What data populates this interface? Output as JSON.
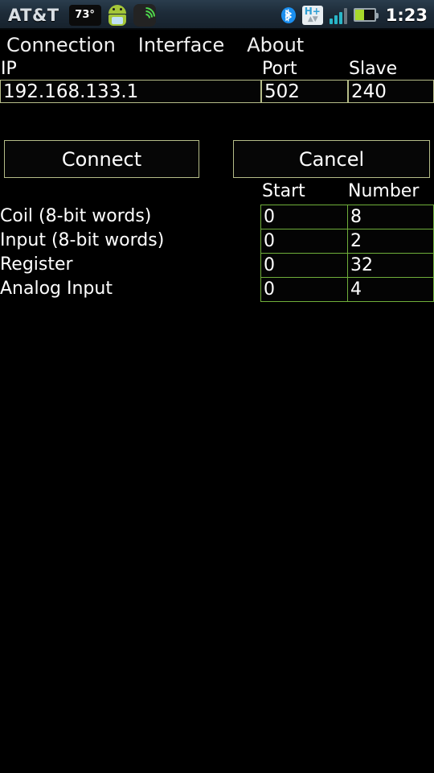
{
  "statusbar": {
    "carrier": "AT&T",
    "weather_temp": "73°",
    "android_icon": "android-robot-icon",
    "spotify_icon": "spotify-icon",
    "bluetooth_icon": "bluetooth-icon",
    "network_type": "H+",
    "network_arrows": "▲▼",
    "signal_bars_lit": 3,
    "signal_bars_total": 4,
    "battery_percent": 45,
    "battery_color": "#a8d92b",
    "clock": "1:23"
  },
  "tabs": [
    {
      "label": "Connection",
      "name": "tab-connection",
      "selected": true
    },
    {
      "label": "Interface",
      "name": "tab-interface",
      "selected": false
    },
    {
      "label": "About",
      "name": "tab-about",
      "selected": false
    }
  ],
  "connection": {
    "ip_label": "IP",
    "ip_value": "192.168.133.1",
    "ip_placeholder": "IP",
    "port_label": "Port",
    "port_value": "502",
    "port_placeholder": "Port",
    "slave_label": "Slave",
    "slave_value": "240",
    "slave_placeholder": "Slave",
    "connect_label": "Connect",
    "cancel_label": "Cancel"
  },
  "registers": {
    "columns": [
      "Start",
      "Number"
    ],
    "col_start": "Start",
    "col_number": "Number",
    "rows": [
      {
        "label": "Coil (8-bit words)",
        "start": "0",
        "number": "8"
      },
      {
        "label": "Input (8-bit words)",
        "start": "0",
        "number": "2"
      },
      {
        "label": "Register",
        "start": "0",
        "number": "32"
      },
      {
        "label": "Analog Input",
        "start": "0",
        "number": "4"
      }
    ]
  },
  "colors": {
    "field_border": "#b5bc88",
    "table_border": "#6fae3a",
    "background": "#000000",
    "text": "#ffffff",
    "statusbar_bg": "#1d2b38"
  }
}
